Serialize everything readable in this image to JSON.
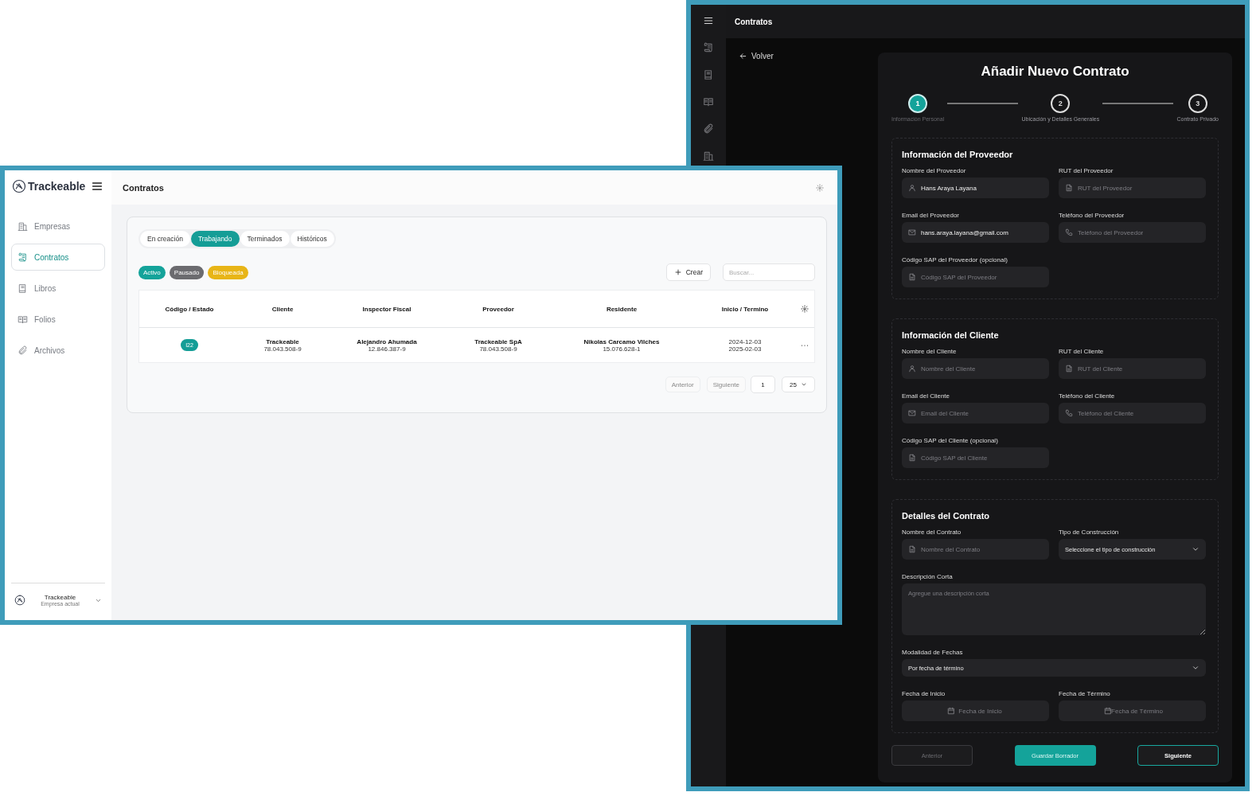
{
  "back_window": {
    "header_title": "Contratos",
    "back_link": "Volver",
    "form": {
      "title": "Añadir Nuevo Contrato",
      "steps": [
        {
          "number": "1",
          "label": "Información Personal",
          "selected": true
        },
        {
          "number": "2",
          "label": "Ubicación y Detalles Generales",
          "selected": false
        },
        {
          "number": "3",
          "label": "Contrato Privado",
          "selected": false
        }
      ],
      "sections": [
        {
          "title": "Información del Proveedor",
          "fields": [
            {
              "kind": "person",
              "label": "Nombre del Proveedor",
              "value": "Hans Araya Layana"
            },
            {
              "kind": "document",
              "label": "RUT del Proveedor",
              "placeholder": "RUT del Proveedor"
            },
            {
              "kind": "email",
              "label": "Email del Proveedor",
              "value": "hans.araya.layana@gmail.com"
            },
            {
              "kind": "phone",
              "label": "Teléfono del Proveedor",
              "placeholder": "Teléfono del Proveedor"
            },
            {
              "kind": "document",
              "label": "Código SAP del Proveedor (opcional)",
              "placeholder": "Código SAP del Proveedor"
            }
          ]
        },
        {
          "title": "Información del Cliente",
          "fields": [
            {
              "kind": "person",
              "label": "Nombre del Cliente",
              "placeholder": "Nombre del Cliente"
            },
            {
              "kind": "document",
              "label": "RUT del Cliente",
              "placeholder": "RUT del Cliente"
            },
            {
              "kind": "email",
              "label": "Email del Cliente",
              "placeholder": "Email del Cliente"
            },
            {
              "kind": "phone",
              "label": "Teléfono del Cliente",
              "placeholder": "Teléfono del Cliente"
            },
            {
              "kind": "document",
              "label": "Código SAP del Cliente (opcional)",
              "placeholder": "Código SAP del Cliente"
            }
          ]
        },
        {
          "title": "Detalles del Contrato",
          "fields": [
            {
              "kind": "document",
              "label": "Nombre del Contrato",
              "placeholder": "Nombre del Contrato"
            },
            {
              "kind": "select",
              "label": "Tipo de Construcción",
              "value": "Seleccione el tipo de construcción"
            },
            {
              "kind": "textarea",
              "label": "Descripción Corta",
              "placeholder": "Agregue una descripción corta"
            },
            {
              "kind": "select",
              "label": "Modalidad de Fechas",
              "value": "Por fecha de término",
              "wide": true
            },
            {
              "kind": "date",
              "label": "Fecha de Inicio",
              "placeholder": "Fecha de Inicio"
            },
            {
              "kind": "date",
              "label": "Fecha de Término",
              "placeholder": "Fecha de Término"
            }
          ]
        }
      ],
      "buttons": [
        {
          "kind": "disabled",
          "label": "Anterior"
        },
        {
          "kind": "primary",
          "label": "Guardar Borrador"
        },
        {
          "kind": "outline",
          "label": "Siguiente"
        }
      ]
    }
  },
  "front_window": {
    "brand": "Trackeable",
    "page_title": "Contratos",
    "sidebar": [
      {
        "label": "Empresas",
        "selected": false
      },
      {
        "label": "Contratos",
        "selected": true
      },
      {
        "label": "Libros",
        "selected": false
      },
      {
        "label": "Folios",
        "selected": false
      },
      {
        "label": "Archivos",
        "selected": false
      }
    ],
    "company": {
      "name": "Trackeable",
      "subtitle": "Empresa actual"
    },
    "tabs": [
      {
        "label": "En creación",
        "selected": false
      },
      {
        "label": "Trabajando",
        "selected": true
      },
      {
        "label": "Terminados",
        "selected": false
      },
      {
        "label": "Históricos",
        "selected": false
      }
    ],
    "status_filters": [
      {
        "label": "Activo",
        "color": "#14a39a"
      },
      {
        "label": "Pausado",
        "color": "#6b6b6f"
      },
      {
        "label": "Bloqueada",
        "color": "#e8b517"
      }
    ],
    "create_button": "Crear",
    "search": {
      "placeholder": "Buscar..."
    },
    "table": {
      "columns": [
        "Código / Estado",
        "Cliente",
        "Inspector Fiscal",
        "Proveedor",
        "Residente",
        "Inicio / Termino"
      ],
      "rows": [
        {
          "cells": [
            {
              "kind": "badge",
              "text": "I22"
            },
            {
              "kind": "party",
              "name": "Trackeable",
              "id": "78.043.508-9"
            },
            {
              "kind": "party",
              "name": "Alejandro Ahumada",
              "id": "12.846.387-9"
            },
            {
              "kind": "party",
              "name": "Trackeable SpA",
              "id": "78.043.508-9"
            },
            {
              "kind": "party",
              "name": "Nikolas Carcamo Vilches",
              "id": "15.076.628-1"
            },
            {
              "kind": "dates",
              "start": "2024-12-03",
              "end": "2025-02-03"
            }
          ]
        }
      ]
    },
    "pagination": {
      "previous": "Anterior",
      "next": "Siguiente",
      "page": "1",
      "page_size": "25"
    }
  }
}
